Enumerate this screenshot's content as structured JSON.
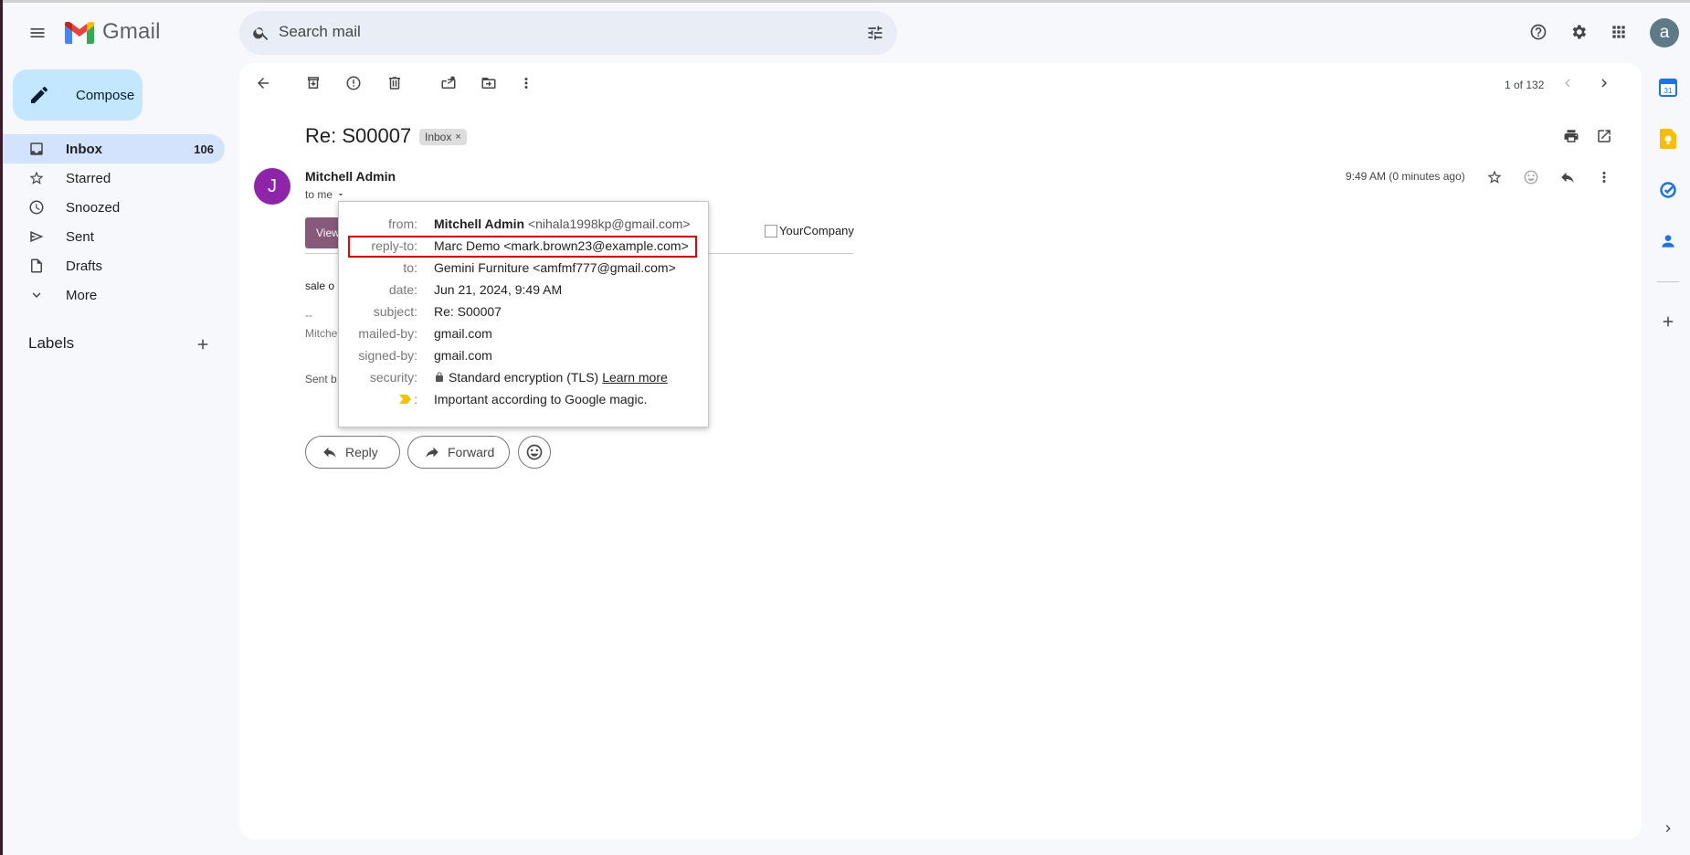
{
  "app": {
    "name": "Gmail"
  },
  "search": {
    "placeholder": "Search mail"
  },
  "header": {
    "avatar_letter": "a"
  },
  "sidebar": {
    "compose_label": "Compose",
    "items": [
      {
        "label": "Inbox",
        "count": "106"
      },
      {
        "label": "Starred"
      },
      {
        "label": "Snoozed"
      },
      {
        "label": "Sent"
      },
      {
        "label": "Drafts"
      },
      {
        "label": "More"
      }
    ],
    "labels_heading": "Labels"
  },
  "toolbar": {
    "pager": "1 of 132"
  },
  "email": {
    "subject": "Re: S00007",
    "inbox_chip": "Inbox",
    "sender": "Mitchell Admin",
    "sender_initial": "J",
    "to_line": "to me",
    "timestamp": "9:49 AM (0 minutes ago)",
    "view_button": "View",
    "company_alt": "YourCompany",
    "body_line_1": "sale o",
    "signature_sep": "--",
    "signature_name": "Mitche",
    "sent_by": "Sent b"
  },
  "details_popup": {
    "rows": [
      {
        "label": "from:",
        "name": "Mitchell Admin",
        "email": "<nihala1998kp@gmail.com>"
      },
      {
        "label": "reply-to:",
        "value": "Marc Demo <mark.brown23@example.com>"
      },
      {
        "label": "to:",
        "value": "Gemini Furniture <amfmf777@gmail.com>"
      },
      {
        "label": "date:",
        "value": "Jun 21, 2024, 9:49 AM"
      },
      {
        "label": "subject:",
        "value": "Re: S00007"
      },
      {
        "label": "mailed-by:",
        "value": "gmail.com"
      },
      {
        "label": "signed-by:",
        "value": "gmail.com"
      },
      {
        "label": "security:",
        "value": "Standard encryption (TLS)",
        "link": "Learn more"
      },
      {
        "label": ":",
        "value": "Important according to Google magic."
      }
    ]
  },
  "actions": {
    "reply": "Reply",
    "forward": "Forward"
  },
  "colors": {
    "accent": "#c2e7ff",
    "active_nav": "#d3e3fd",
    "sender_avatar": "#8e24aa",
    "view_button": "#875a7b",
    "highlight": "#e00000"
  }
}
